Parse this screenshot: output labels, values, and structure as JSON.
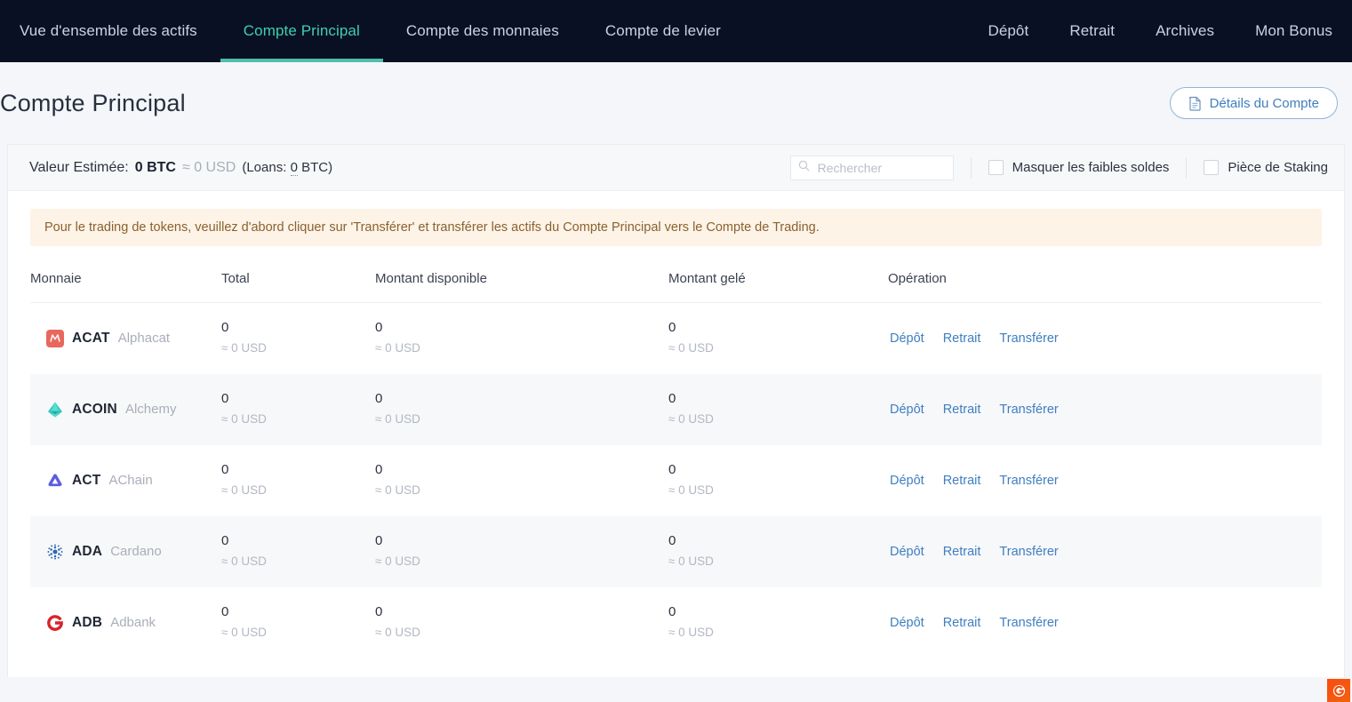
{
  "nav": {
    "left": [
      {
        "label": "Vue d'ensemble des actifs",
        "active": false
      },
      {
        "label": "Compte Principal",
        "active": true
      },
      {
        "label": "Compte des monnaies",
        "active": false
      },
      {
        "label": "Compte de levier",
        "active": false
      }
    ],
    "right": [
      {
        "label": "Dépôt"
      },
      {
        "label": "Retrait"
      },
      {
        "label": "Archives"
      },
      {
        "label": "Mon Bonus"
      }
    ]
  },
  "page": {
    "title": "Compte Principal",
    "details_button": "Détails du Compte",
    "details_icon": "document-icon"
  },
  "summary": {
    "estimated_label": "Valeur Estimée:",
    "btc_value": "0 BTC",
    "usd_value": "≈ 0 USD",
    "loans_prefix": "(Loans:",
    "loans_value": "0",
    "loans_suffix": "BTC)",
    "search_placeholder": "Rechercher",
    "search_value": "",
    "search_icon": "search-icon",
    "hide_small_label": "Masquer les faibles soldes",
    "hide_small_checked": false,
    "staking_label": "Pièce de Staking",
    "staking_checked": false
  },
  "alert": {
    "text": "Pour le trading de tokens, veuillez d'abord cliquer sur 'Transférer' et transférer les actifs du Compte Principal vers le Compte de Trading."
  },
  "table": {
    "headers": {
      "coin": "Monnaie",
      "total": "Total",
      "available": "Montant disponible",
      "frozen": "Montant gelé",
      "operation": "Opération"
    },
    "ops": {
      "deposit": "Dépôt",
      "withdraw": "Retrait",
      "transfer": "Transférer"
    },
    "rows": [
      {
        "symbol": "ACAT",
        "name": "Alphacat",
        "icon": "acat-icon",
        "icon_color": "#e8685d",
        "total": "0",
        "total_usd": "≈ 0 USD",
        "available": "0",
        "available_usd": "≈ 0 USD",
        "frozen": "0",
        "frozen_usd": "≈ 0 USD"
      },
      {
        "symbol": "ACOIN",
        "name": "Alchemy",
        "icon": "acoin-icon",
        "icon_color": "#3fc9c0",
        "total": "0",
        "total_usd": "≈ 0 USD",
        "available": "0",
        "available_usd": "≈ 0 USD",
        "frozen": "0",
        "frozen_usd": "≈ 0 USD"
      },
      {
        "symbol": "ACT",
        "name": "AChain",
        "icon": "act-icon",
        "icon_color": "#5a5fe0",
        "total": "0",
        "total_usd": "≈ 0 USD",
        "available": "0",
        "available_usd": "≈ 0 USD",
        "frozen": "0",
        "frozen_usd": "≈ 0 USD"
      },
      {
        "symbol": "ADA",
        "name": "Cardano",
        "icon": "ada-icon",
        "icon_color": "#2f66b3",
        "total": "0",
        "total_usd": "≈ 0 USD",
        "available": "0",
        "available_usd": "≈ 0 USD",
        "frozen": "0",
        "frozen_usd": "≈ 0 USD"
      },
      {
        "symbol": "ADB",
        "name": "Adbank",
        "icon": "adb-icon",
        "icon_color": "#d8232a",
        "total": "0",
        "total_usd": "≈ 0 USD",
        "available": "0",
        "available_usd": "≈ 0 USD",
        "frozen": "0",
        "frozen_usd": "≈ 0 USD"
      }
    ]
  },
  "corner": {
    "icon": "widget-launcher-icon",
    "color": "#f4500f"
  },
  "theme": {
    "nav_bg": "#091024",
    "accent_teal": "#4fbfab",
    "link_blue": "#3f7fbf",
    "alert_bg": "#fdf3e7",
    "alert_fg": "#8a6230"
  }
}
